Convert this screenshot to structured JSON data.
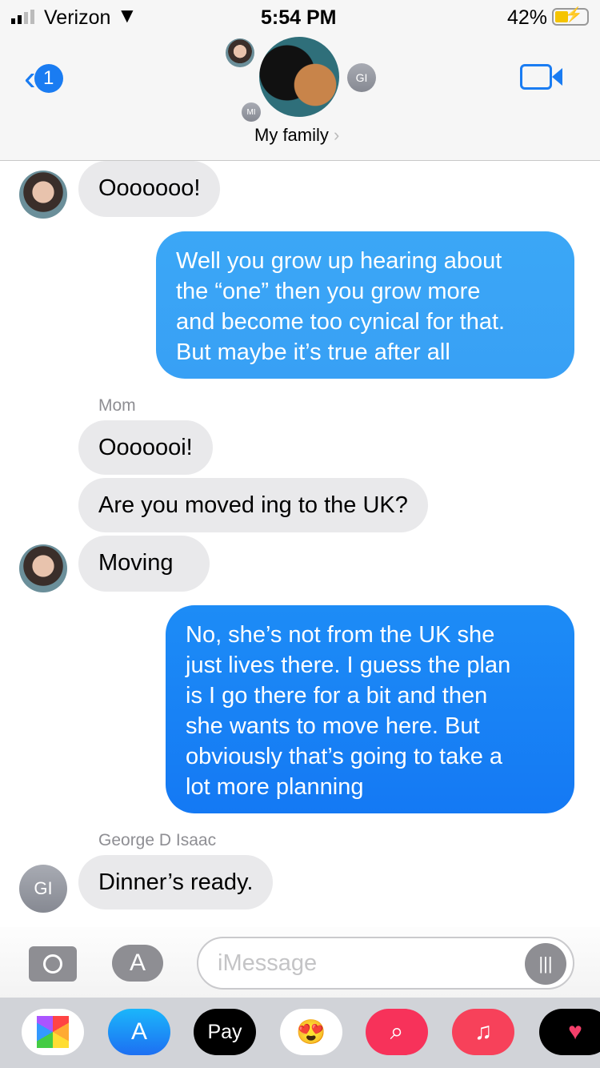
{
  "status_bar": {
    "carrier": "Verizon",
    "time": "5:54 PM",
    "battery": "42%"
  },
  "header": {
    "back_badge": "1",
    "group_name": "My family",
    "chevron": "›",
    "members": [
      {
        "initials": "MI"
      },
      {
        "initials": "GI"
      }
    ]
  },
  "messages": [
    {
      "direction": "in",
      "text": "Ooooooo!"
    },
    {
      "direction": "out",
      "lines": [
        "Well you grow up hearing about",
        "the “one” then you grow more",
        "and become too cynical for that.",
        "But maybe it’s true after all"
      ]
    },
    {
      "direction": "in",
      "sender": "Mom",
      "text": "Ooooooi!"
    },
    {
      "direction": "in",
      "text": "Are you moved ing to the UK?"
    },
    {
      "direction": "in",
      "text": "Moving"
    },
    {
      "direction": "out",
      "lines": [
        "No, she’s not from the UK she",
        "just lives there. I guess the plan",
        "is I go there for a bit and then",
        "she wants to move here. But",
        "obviously that’s going to take a",
        "lot more planning"
      ]
    },
    {
      "direction": "in",
      "sender": "George D Isaac",
      "avatar": "GI",
      "text": "Dinner’s ready."
    }
  ],
  "input": {
    "placeholder": "iMessage"
  },
  "dock": {
    "apple_pay": "Pay",
    "apps": [
      "photos",
      "app-store",
      "apple-pay",
      "memoji",
      "images-search",
      "music",
      "heart-app"
    ]
  }
}
